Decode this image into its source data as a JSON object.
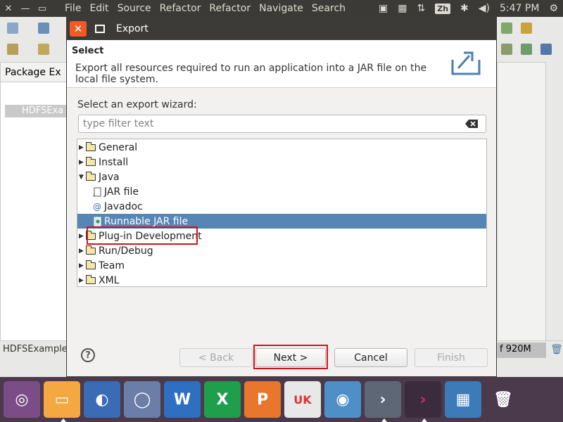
{
  "topbar": {
    "menu": [
      "File",
      "Edit",
      "Source",
      "Refactor",
      "Refactor",
      "Navigate",
      "Search"
    ],
    "indicators": {
      "input_method": "Zh",
      "clock": "5:47 PM"
    }
  },
  "workbench": {
    "package_explorer_title": "Package Ex",
    "tree_item": "HDFSExa",
    "status_text": "HDFSExample",
    "heap_text": "f 920M"
  },
  "dialog": {
    "title": "Export",
    "header_title": "Select",
    "header_description": "Export all resources required to run an application into a JAR file on the local file system.",
    "wizard_label": "Select an export wizard:",
    "filter_placeholder": "type filter text",
    "tree": [
      {
        "label": "General",
        "kind": "folder",
        "expanded": false
      },
      {
        "label": "Install",
        "kind": "folder",
        "expanded": false
      },
      {
        "label": "Java",
        "kind": "folder",
        "expanded": true
      },
      {
        "label": "JAR file",
        "kind": "jar-file"
      },
      {
        "label": "Javadoc",
        "kind": "javadoc"
      },
      {
        "label": "Runnable JAR file",
        "kind": "runnable-jar",
        "selected": true
      },
      {
        "label": "Plug-in Development",
        "kind": "folder",
        "expanded": false
      },
      {
        "label": "Run/Debug",
        "kind": "folder",
        "expanded": false
      },
      {
        "label": "Team",
        "kind": "folder",
        "expanded": false
      },
      {
        "label": "XML",
        "kind": "folder",
        "expanded": false
      }
    ],
    "buttons": {
      "help": "?",
      "back": "< Back",
      "next": "Next >",
      "cancel": "Cancel",
      "finish": "Finish"
    }
  },
  "dock": {
    "items": [
      "ubuntu-logo-icon",
      "files-icon",
      "firefox-icon",
      "chromium-icon",
      "wps-writer-icon",
      "wps-spreadsheets-icon",
      "wps-presentation-icon",
      "ubuntu-one-store-icon",
      "remmina-icon",
      "eclipse-terminal-icon",
      "terminal-icon",
      "app-grid-icon",
      "trash-icon"
    ],
    "uk_label": "UK"
  },
  "colors": {
    "selection": "#5586b5",
    "highlight_box": "#d0141c",
    "close_button": "#f25a24"
  }
}
